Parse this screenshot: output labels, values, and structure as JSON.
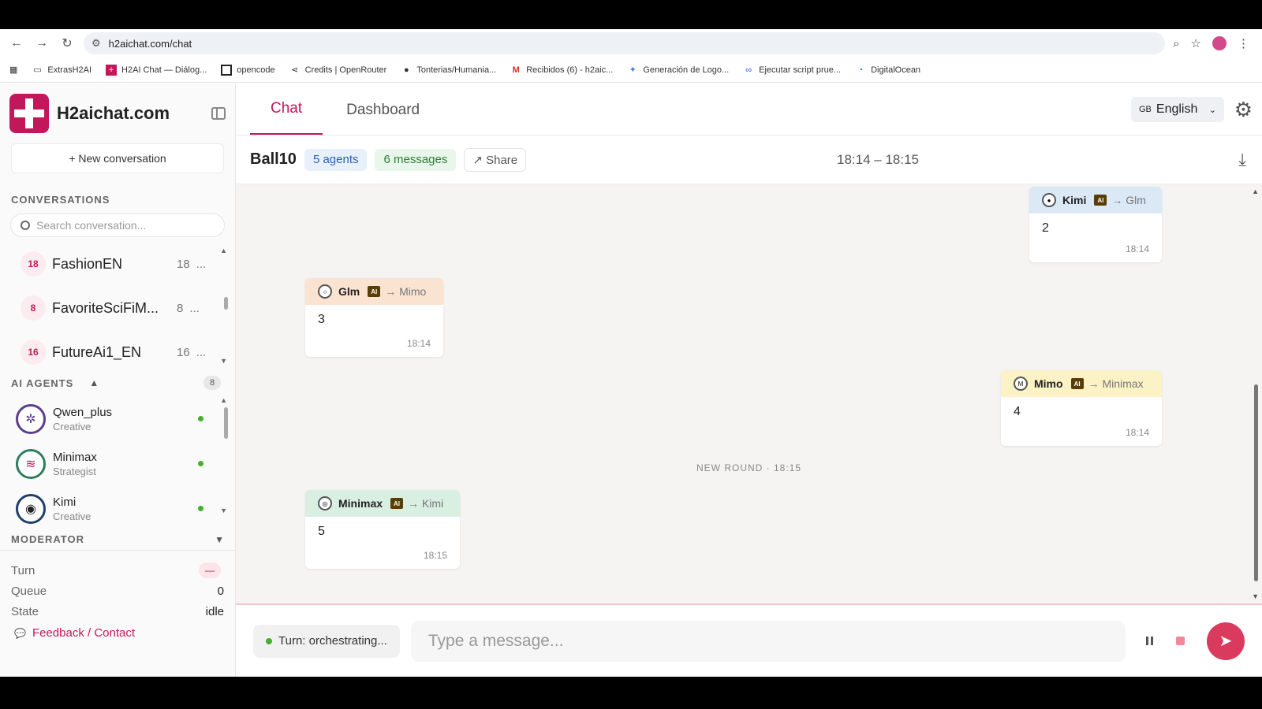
{
  "browser": {
    "url": "h2aichat.com/chat",
    "bookmarks": [
      {
        "label": "ExtrasH2AI",
        "icon": "folder-icon"
      },
      {
        "label": "H2AI Chat — Diálog...",
        "icon": "h2ai-icon"
      },
      {
        "label": "opencode",
        "icon": "opencode-icon"
      },
      {
        "label": "Credits | OpenRouter",
        "icon": "openrouter-icon"
      },
      {
        "label": "Tonterias/Humania...",
        "icon": "github-icon"
      },
      {
        "label": "Recibidos (6) - h2aic...",
        "icon": "gmail-icon"
      },
      {
        "label": "Generación de Logo...",
        "icon": "sparkle-icon"
      },
      {
        "label": "Ejecutar script prue...",
        "icon": "script-icon"
      },
      {
        "label": "DigitalOcean",
        "icon": "digitalocean-icon"
      }
    ]
  },
  "sidebar": {
    "brand": "H2aichat.com",
    "new_conversation": "+ New conversation",
    "conversations_title": "CONVERSATIONS",
    "search_placeholder": "Search conversation...",
    "conversations": [
      {
        "badge": "18",
        "name": "FashionEN",
        "count": "18",
        "more": "..."
      },
      {
        "badge": "8",
        "name": "FavoriteSciFiM...",
        "count": "8",
        "more": "..."
      },
      {
        "badge": "16",
        "name": "FutureAi1_EN",
        "count": "16",
        "more": "..."
      }
    ],
    "agents_title": "AI AGENTS",
    "agents_count": "8",
    "agents": [
      {
        "name": "Qwen_plus",
        "role": "Creative",
        "color": "#5b3e8e"
      },
      {
        "name": "Minimax",
        "role": "Strategist",
        "color": "#2e7d5b"
      },
      {
        "name": "Kimi",
        "role": "Creative",
        "color": "#1f3f6e"
      }
    ],
    "moderator_title": "MODERATOR",
    "moderator": {
      "turn_label": "Turn",
      "turn_value": "—",
      "queue_label": "Queue",
      "queue_value": "0",
      "state_label": "State",
      "state_value": "idle"
    },
    "feedback": "Feedback / Contact"
  },
  "main": {
    "tabs": [
      "Chat",
      "Dashboard"
    ],
    "active_tab": "Chat",
    "language": {
      "flag": "GB",
      "label": "English"
    },
    "chat": {
      "title": "Ball10",
      "agents_pill": "5 agents",
      "messages_pill": "6 messages",
      "share": "↗ Share",
      "time_range": "18:14 – 18:15"
    },
    "messages": [
      {
        "sender": "Kimi",
        "ai": "AI",
        "target": "→ Glm",
        "text": "2",
        "time": "18:14",
        "color": "#dbe8f6"
      },
      {
        "sender": "Glm",
        "ai": "AI",
        "target": "→ Mimo",
        "text": "3",
        "time": "18:14",
        "color": "#fbe3d2"
      },
      {
        "sender": "Mimo",
        "ai": "AI",
        "target": "→ Minimax",
        "text": "4",
        "time": "18:14",
        "color": "#fbf2c6"
      },
      {
        "sender": "Minimax",
        "ai": "AI",
        "target": "→ Kimi",
        "text": "5",
        "time": "18:15",
        "color": "#d8efe2"
      }
    ],
    "round_divider": "NEW ROUND · 18:15",
    "composer": {
      "status": "Turn: orchestrating...",
      "placeholder": "Type a message..."
    }
  }
}
